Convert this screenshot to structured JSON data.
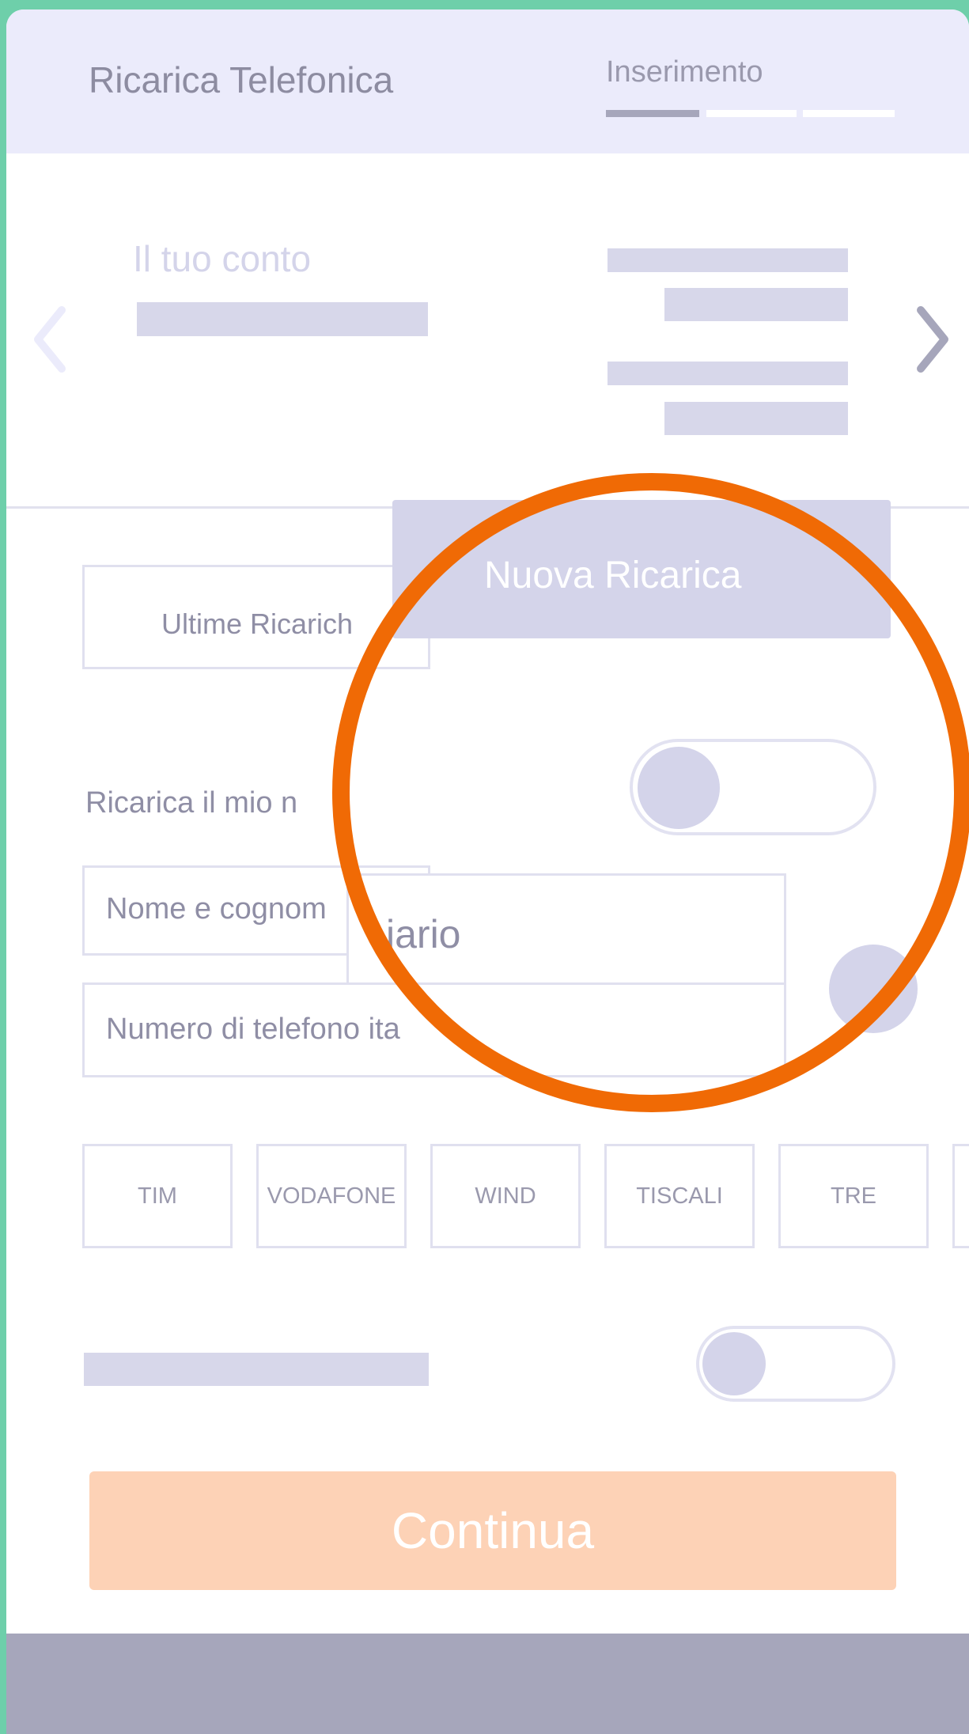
{
  "header": {
    "title": "Ricarica Telefonica",
    "step_label": "Inserimento",
    "steps_total": 3,
    "step_current": 1
  },
  "account": {
    "label": "Il tuo conto",
    "prev_icon": "chevron-left-icon",
    "next_icon": "chevron-right-icon"
  },
  "tabs": {
    "last": "Ultime Ricarich",
    "new": "Nuova Ricarica"
  },
  "form": {
    "own_number_label": "Ricarica il mio n",
    "name_placeholder": "Nome e cognom",
    "name_zoom_text": "iario",
    "phone_placeholder": "Numero di telefono ita",
    "own_number_toggle": false,
    "bottom_toggle": false
  },
  "operators": [
    "TIM",
    "VODAFONE",
    "WIND",
    "TISCALI",
    "TRE"
  ],
  "continue_label": "Continua",
  "colors": {
    "accent_orange": "#f06a05",
    "continue_bg": "#fdd2b6",
    "placeholder": "#d7d7ea",
    "footer": "#a6a6bb",
    "header_bg": "#ebebfb",
    "app_bg": "#6ecfaa"
  }
}
